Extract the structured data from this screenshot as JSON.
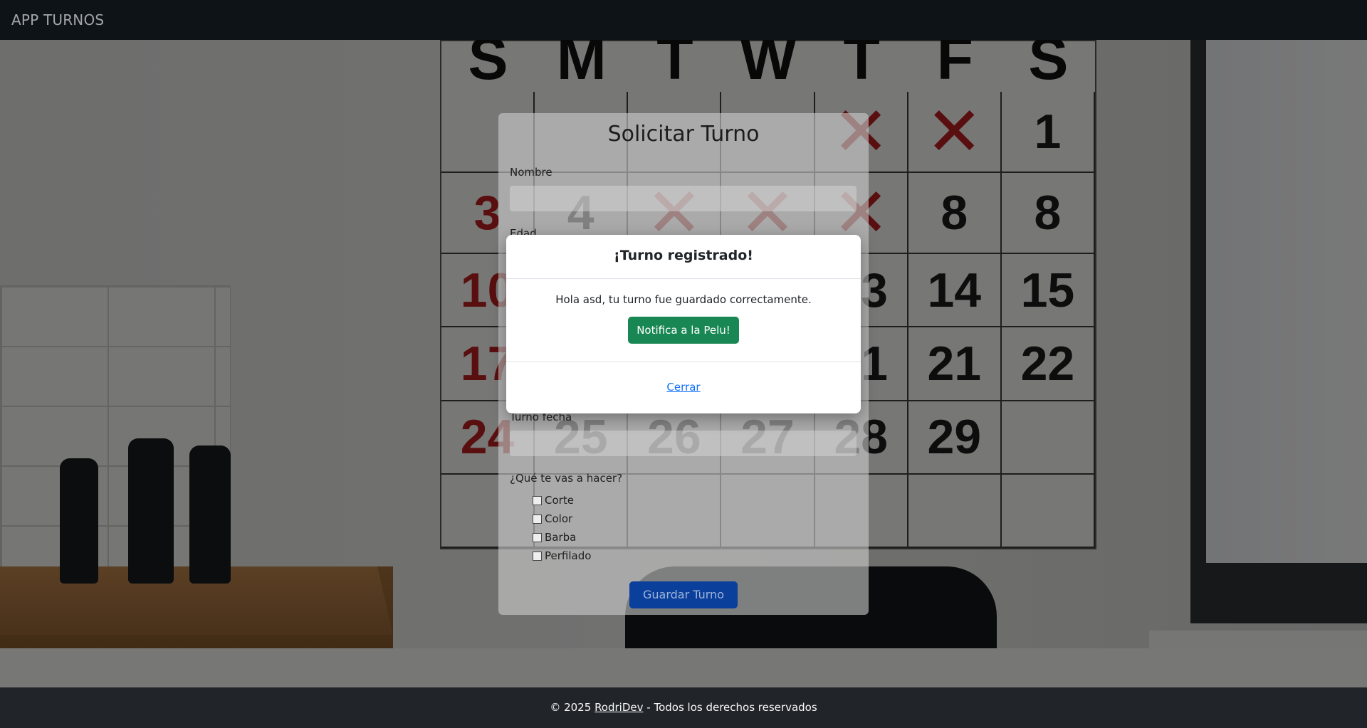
{
  "navbar": {
    "brand": "APP TURNOS"
  },
  "background": {
    "calendar": {
      "days": [
        "S",
        "M",
        "T",
        "W",
        "T",
        "F",
        "S"
      ],
      "cells": [
        [
          "",
          "",
          "",
          "",
          "×",
          "×",
          "1"
        ],
        [
          "3",
          "4",
          "×",
          "×",
          "×",
          "8",
          "8"
        ],
        [
          "10",
          "",
          "",
          "",
          "13",
          "14",
          "15"
        ],
        [
          "17",
          "",
          "",
          "",
          "21",
          "21",
          "22"
        ],
        [
          "24",
          "25",
          "26",
          "27",
          "28",
          "29",
          ""
        ],
        [
          "",
          "",
          "",
          "",
          "",
          "",
          ""
        ]
      ]
    }
  },
  "form": {
    "title": "Solicitar Turno",
    "labels": {
      "nombre": "Nombre",
      "edad": "Edad",
      "fecha": "Turno fecha",
      "servicios": "¿Qué te vas a hacer?"
    },
    "services": [
      "Corte",
      "Color",
      "Barba",
      "Perfilado"
    ],
    "submit": "Guardar Turno"
  },
  "modal": {
    "title": "¡Turno registrado!",
    "message": "Hola asd, tu turno fue guardado correctamente.",
    "notify_button": "Notifica a la Pelu!",
    "close_link": "Cerrar"
  },
  "footer": {
    "prefix": "© 2025",
    "author": "RodriDev",
    "suffix": "- Todos los derechos reservados"
  },
  "colors": {
    "navbar_bg": "#0e1318",
    "footer_bg": "#212529",
    "primary": "#0d6efd",
    "success": "#198754"
  }
}
